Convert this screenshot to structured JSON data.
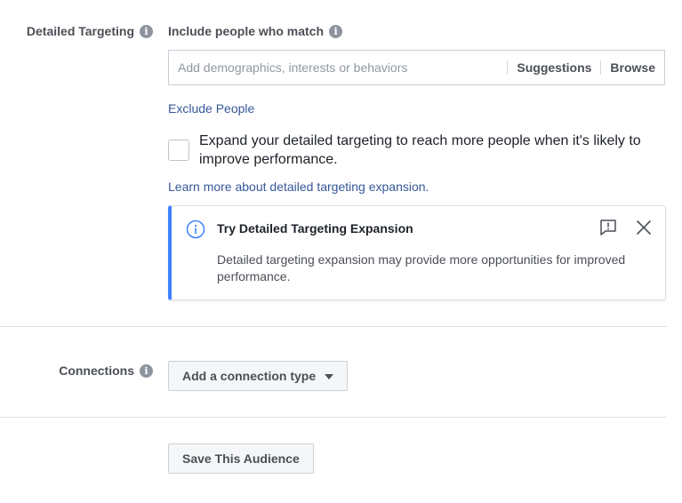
{
  "detailed_targeting": {
    "label": "Detailed Targeting",
    "info_glyph": "i",
    "include_label": "Include people who match",
    "search_placeholder": "Add demographics, interests or behaviors",
    "suggestions_label": "Suggestions",
    "browse_label": "Browse",
    "exclude_label": "Exclude People",
    "expand_checkbox_text": "Expand your detailed targeting to reach more people when it's likely to improve performance.",
    "expand_checked": false,
    "learn_more_label": "Learn more about detailed targeting expansion.",
    "card": {
      "title": "Try Detailed Targeting Expansion",
      "body": "Detailed targeting expansion may provide more opportunities for improved performance.",
      "accent_color": "#4080ff",
      "icons": [
        "info-circle-icon",
        "feedback-icon",
        "close-icon"
      ]
    }
  },
  "connections": {
    "label": "Connections",
    "button_label": "Add a connection type"
  },
  "save_audience_label": "Save This Audience",
  "colors": {
    "link": "#365899",
    "label": "#4b4f56",
    "border": "#dddfe2"
  }
}
